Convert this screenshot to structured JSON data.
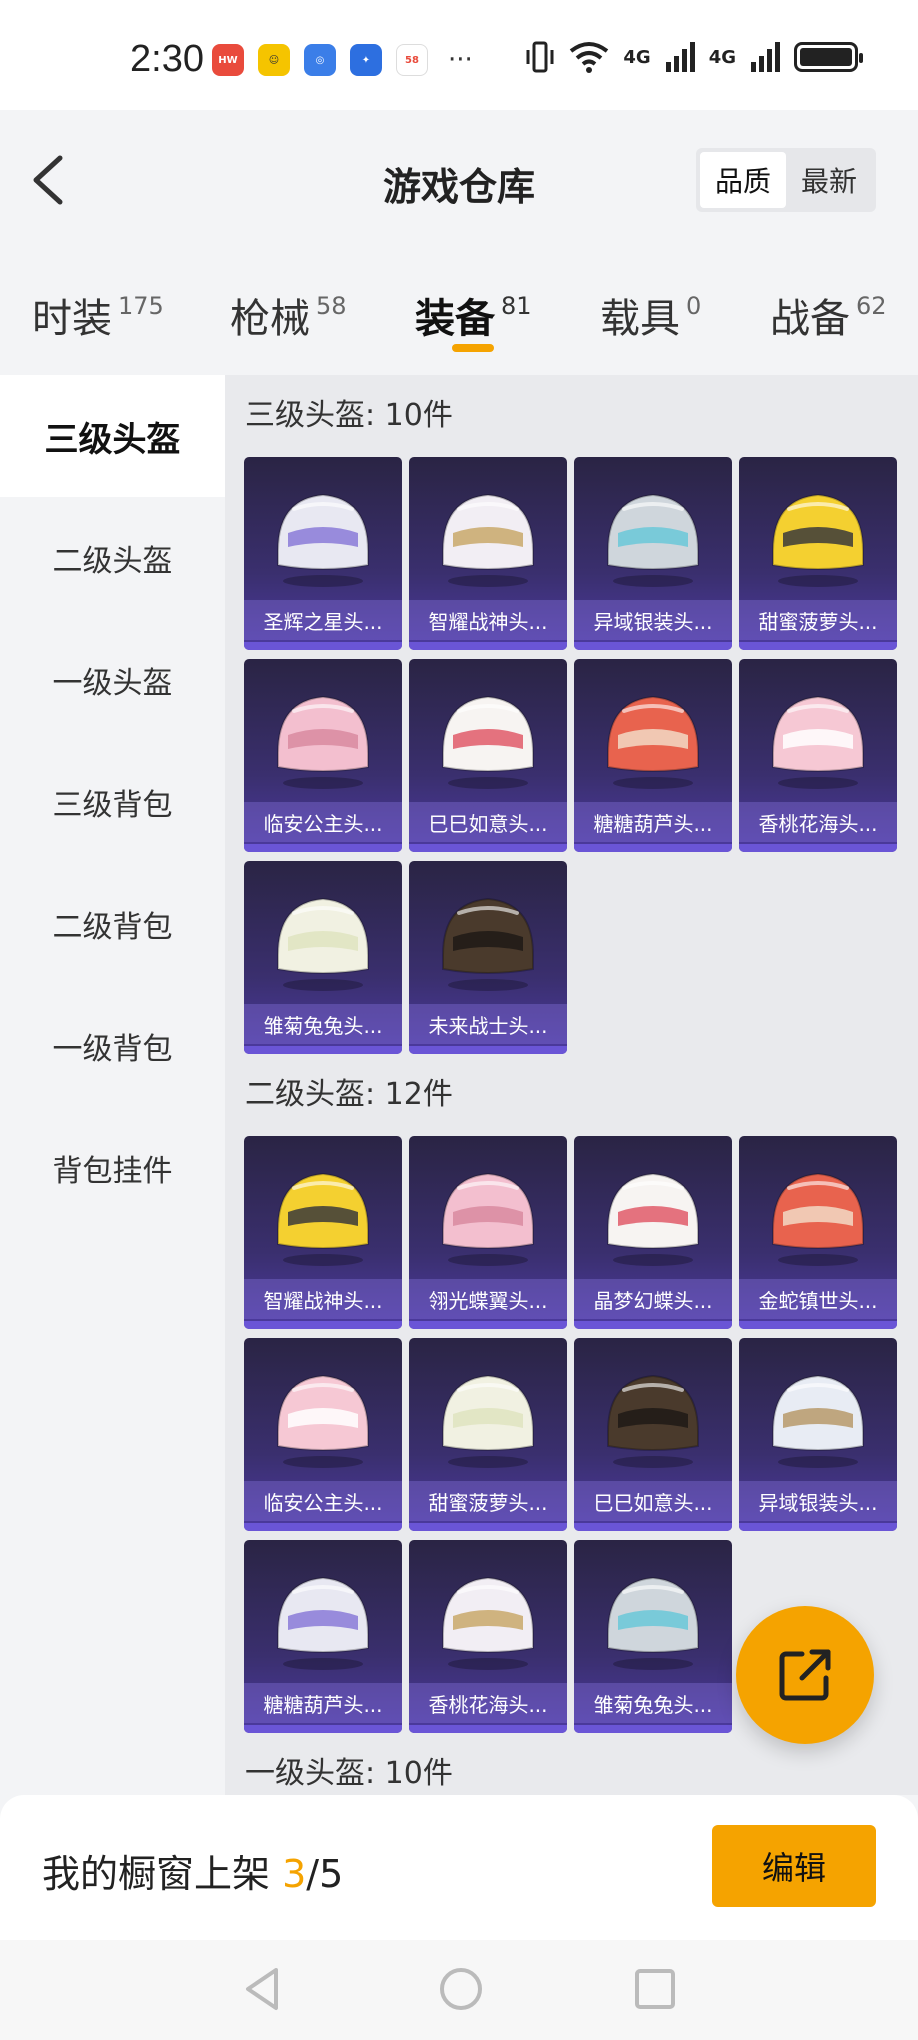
{
  "status_bar": {
    "time": "2:30",
    "network_1": "4G",
    "network_2": "4G",
    "more": "···",
    "apps": [
      "huawei-app",
      "game-app",
      "browser-app",
      "bulb-app",
      "58-app"
    ]
  },
  "header": {
    "title": "游戏仓库",
    "sort_quality": "品质",
    "sort_newest": "最新"
  },
  "tabs": [
    {
      "label": "时装",
      "count": "175"
    },
    {
      "label": "枪械",
      "count": "58"
    },
    {
      "label": "装备",
      "count": "81"
    },
    {
      "label": "载具",
      "count": "0"
    },
    {
      "label": "战备",
      "count": "62"
    }
  ],
  "sidenav": [
    "三级头盔",
    "二级头盔",
    "一级头盔",
    "三级背包",
    "二级背包",
    "一级背包",
    "背包挂件"
  ],
  "sections": [
    {
      "title": "三级头盔: 10件",
      "items": [
        "圣辉之星头...",
        "智耀战神头...",
        "异域银装头...",
        "甜蜜菠萝头...",
        "临安公主头...",
        "巳巳如意头...",
        "糖糖葫芦头...",
        "香桃花海头...",
        "雏菊兔兔头...",
        "未来战士头..."
      ]
    },
    {
      "title": "二级头盔: 12件",
      "items": [
        "智耀战神头...",
        "翎光蝶翼头...",
        "晶梦幻蝶头...",
        "金蛇镇世头...",
        "临安公主头...",
        "甜蜜菠萝头...",
        "巳巳如意头...",
        "异域银装头...",
        "糖糖葫芦头...",
        "香桃花海头...",
        "雏菊兔兔头..."
      ]
    },
    {
      "title": "一级头盔: 10件",
      "items": []
    }
  ],
  "bottom": {
    "shelf_label": "我的橱窗上架 ",
    "shelf_used": "3",
    "shelf_total": "/5",
    "edit_label": "编辑"
  },
  "colors": {
    "accent": "#f5a300",
    "card_top": "#2a2444",
    "card_bottom": "#4c3aa0"
  }
}
